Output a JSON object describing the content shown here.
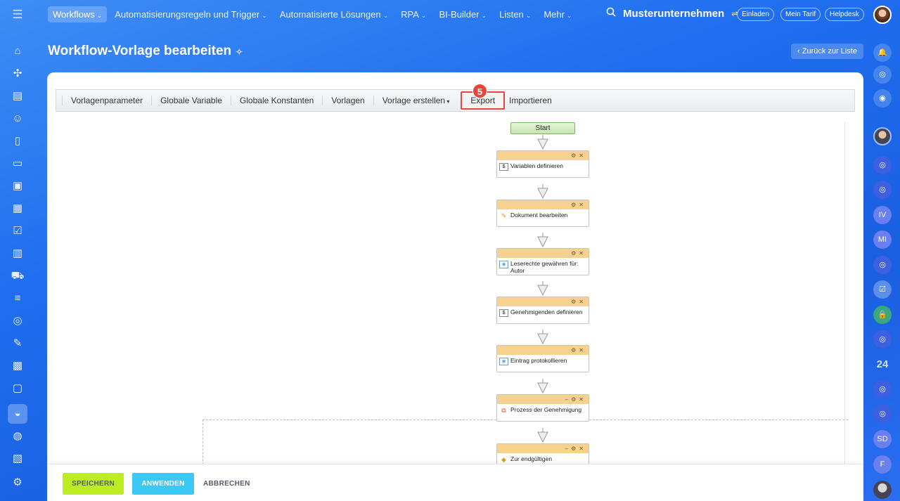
{
  "topnav": {
    "items": [
      {
        "label": "Workflows",
        "active": true
      },
      {
        "label": "Automatisierungsregeln und Trigger"
      },
      {
        "label": "Automatisierte Lösungen"
      },
      {
        "label": "RPA"
      },
      {
        "label": "BI-Builder"
      },
      {
        "label": "Listen"
      },
      {
        "label": "Mehr"
      }
    ],
    "company": "Musterunternehmen",
    "invite": "Einladen",
    "tariff": "Mein Tarif",
    "helpdesk": "Helpdesk"
  },
  "page": {
    "title": "Workflow-Vorlage bearbeiten",
    "back_label": "Zurück zur Liste"
  },
  "toolbar": {
    "items": [
      "Vorlagenparameter",
      "Globale Variable",
      "Globale Konstanten",
      "Vorlagen",
      "Vorlage erstellen"
    ],
    "export_label": "Export",
    "import_label": "Importieren",
    "step_badge": "5"
  },
  "workflow": {
    "start_label": "Start",
    "blocks": [
      {
        "label": "Variablen definieren",
        "icon": "variable-icon"
      },
      {
        "label": "Dokument bearbeiten",
        "icon": "edit-document-icon"
      },
      {
        "label": "Leserechte gewähren für: Autor",
        "icon": "permission-icon"
      },
      {
        "label": "Genehmigenden definieren",
        "icon": "variable-icon"
      },
      {
        "label": "Eintrag protokollieren",
        "icon": "log-icon"
      },
      {
        "label": "Prozess der Genehmigung",
        "icon": "approval-icon"
      },
      {
        "label": "Zur endgültigen",
        "icon": "warning-icon"
      }
    ]
  },
  "footer": {
    "save": "SPEICHERN",
    "apply": "ANWENDEN",
    "cancel": "ABBRECHEN"
  },
  "rightbar": {
    "badges": [
      "IV",
      "MI",
      "24",
      "SD",
      "F"
    ]
  },
  "colors": {
    "accent": "#1f6ff0",
    "save_button": "#bbed21",
    "apply_button": "#3bc8f5",
    "highlight": "#e0493b",
    "block_header": "#f6d28e"
  }
}
